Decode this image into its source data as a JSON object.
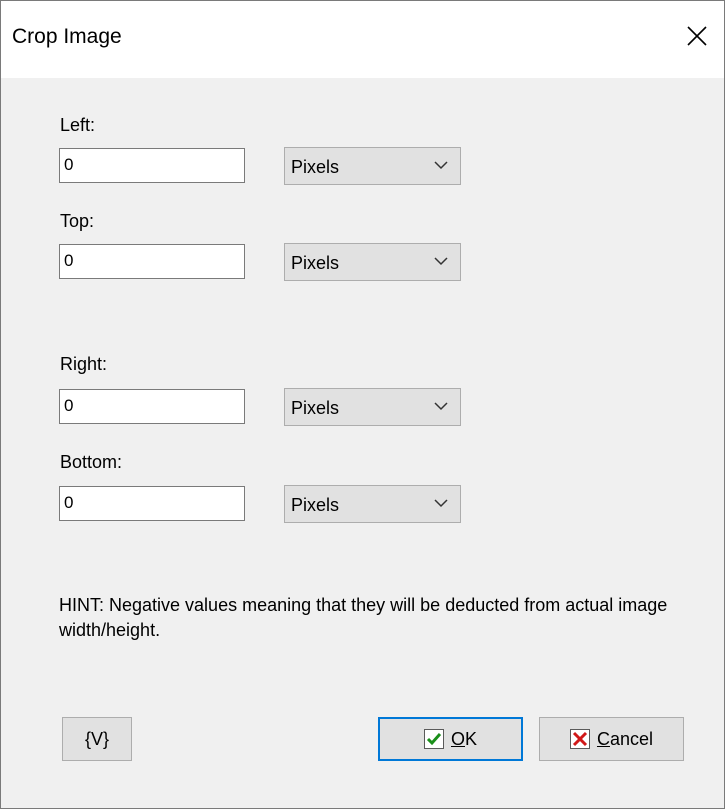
{
  "window": {
    "title": "Crop Image"
  },
  "fields": {
    "left": {
      "label": "Left:",
      "value": "0",
      "unit": "Pixels"
    },
    "top": {
      "label": "Top:",
      "value": "0",
      "unit": "Pixels"
    },
    "right": {
      "label": "Right:",
      "value": "0",
      "unit": "Pixels"
    },
    "bottom": {
      "label": "Bottom:",
      "value": "0",
      "unit": "Pixels"
    }
  },
  "hint": "HINT: Negative values meaning that they will be deducted from actual image width/height.",
  "buttons": {
    "variables": "{V}",
    "ok": "OK",
    "cancel": "Cancel"
  },
  "icons": {
    "close": "close-icon",
    "ok": "checkmark-icon",
    "cancel": "x-icon",
    "dropdown": "chevron-down-icon"
  },
  "colors": {
    "ok_check": "#1a8f1a",
    "cancel_x": "#d01818",
    "focus_border": "#0078d7"
  }
}
